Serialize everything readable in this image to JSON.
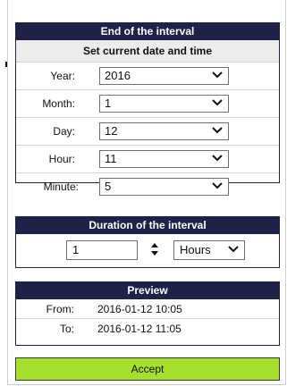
{
  "end_interval": {
    "title": "End of the interval",
    "subtitle": "Set current date and time",
    "fields": [
      {
        "label": "Year:",
        "value": "2016"
      },
      {
        "label": "Month:",
        "value": "1"
      },
      {
        "label": "Day:",
        "value": "12"
      },
      {
        "label": "Hour:",
        "value": "11"
      },
      {
        "label": "Minute:",
        "value": "5"
      }
    ]
  },
  "duration": {
    "title": "Duration of the interval",
    "amount": "1",
    "unit": "Hours"
  },
  "preview": {
    "title": "Preview",
    "from_label": "From:",
    "from_value": "2016-01-12 10:05",
    "to_label": "To:",
    "to_value": "2016-01-12 11:05"
  },
  "actions": {
    "accept_label": "Accept"
  },
  "colors": {
    "header_bg": "#1e2248",
    "accept_bg": "#a6e02e"
  }
}
